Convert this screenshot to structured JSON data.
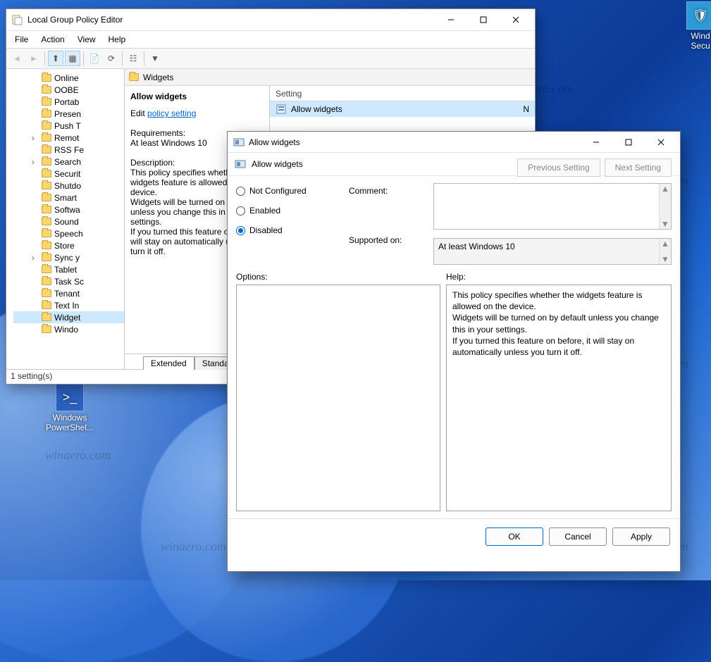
{
  "desktop": {
    "icons": [
      {
        "label": "Windows PowerShel..."
      },
      {
        "label": "Wind\nSecu"
      }
    ]
  },
  "gpedit": {
    "title": "Local Group Policy Editor",
    "menu": [
      "File",
      "Action",
      "View",
      "Help"
    ],
    "tree_items": [
      {
        "label": "Online",
        "exp": false
      },
      {
        "label": "OOBE",
        "exp": false
      },
      {
        "label": "Portab",
        "exp": false
      },
      {
        "label": "Presen",
        "exp": false
      },
      {
        "label": "Push T",
        "exp": false
      },
      {
        "label": "Remot",
        "exp": true
      },
      {
        "label": "RSS Fe",
        "exp": false
      },
      {
        "label": "Search",
        "exp": true
      },
      {
        "label": "Securit",
        "exp": false
      },
      {
        "label": "Shutdo",
        "exp": false
      },
      {
        "label": "Smart",
        "exp": false
      },
      {
        "label": "Softwa",
        "exp": false
      },
      {
        "label": "Sound",
        "exp": false
      },
      {
        "label": "Speech",
        "exp": false
      },
      {
        "label": "Store",
        "exp": false
      },
      {
        "label": "Sync y",
        "exp": true
      },
      {
        "label": "Tablet",
        "exp": false
      },
      {
        "label": "Task Sc",
        "exp": false
      },
      {
        "label": "Tenant",
        "exp": false
      },
      {
        "label": "Text In",
        "exp": false
      },
      {
        "label": "Widget",
        "exp": false,
        "sel": true
      },
      {
        "label": "Windo",
        "exp": false
      }
    ],
    "path_label": "Widgets",
    "left_header": "Allow widgets",
    "edit_prefix": "Edit ",
    "edit_link": "policy setting ",
    "req_label": "Requirements:",
    "req_value": "At least Windows 10",
    "desc_label": "Description:",
    "desc_text": "This policy specifies whethe\nwidgets feature is allowed o\ndevice.\nWidgets will be turned on b\nunless you change this in y\nsettings.\nIf you turned this feature on\nwill stay on automatically u\nturn it off.",
    "col_setting": "Setting",
    "row_setting": "Allow widgets",
    "row_state": "N",
    "tabs": [
      "Extended",
      "Standard"
    ],
    "status": "1 setting(s)"
  },
  "dlg": {
    "title": "Allow widgets",
    "header": "Allow widgets",
    "prev": "Previous Setting",
    "next": "Next Setting",
    "radios": {
      "not_configured": "Not Configured",
      "enabled": "Enabled",
      "disabled": "Disabled"
    },
    "comment_label": "Comment:",
    "supported_label": "Supported on:",
    "supported_value": "At least Windows 10",
    "options_label": "Options:",
    "help_label": "Help:",
    "help_text": "This policy specifies whether the widgets feature is allowed on the device.\nWidgets will be turned on by default unless you change this in your settings.\nIf you turned this feature on before, it will stay on automatically unless you turn it off.",
    "ok": "OK",
    "cancel": "Cancel",
    "apply": "Apply"
  },
  "watermark": "winaero.com"
}
